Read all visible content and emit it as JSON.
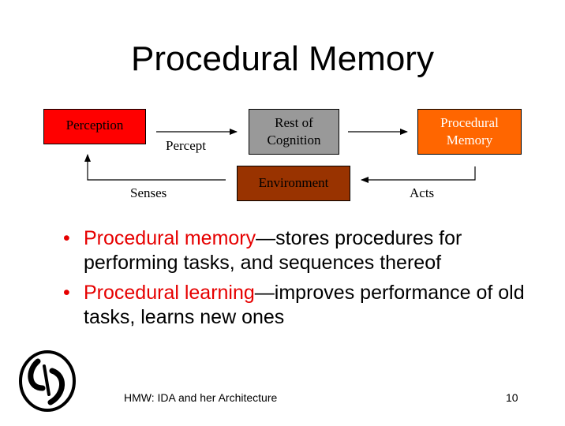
{
  "slide": {
    "title": "Procedural Memory",
    "diagram": {
      "perception": "Perception",
      "rest_of_cognition": "Rest of\nCognition",
      "procedural_memory": "Procedural\nMemory",
      "environment": "Environment",
      "percept_label": "Percept",
      "senses_label": "Senses",
      "acts_label": "Acts"
    },
    "bullets": [
      {
        "term": "Procedural memory",
        "text": "—stores procedures for performing tasks, and sequences thereof"
      },
      {
        "term": "Procedural learning",
        "text": "—improves performance of old tasks, learns new ones"
      }
    ],
    "footer": "HMW: IDA and her Architecture",
    "page_number": "10",
    "colors": {
      "perception": "#ff0000",
      "rest_of_cognition": "#999999",
      "procedural_memory": "#ff6600",
      "environment": "#993300",
      "highlight": "#e60000"
    }
  }
}
